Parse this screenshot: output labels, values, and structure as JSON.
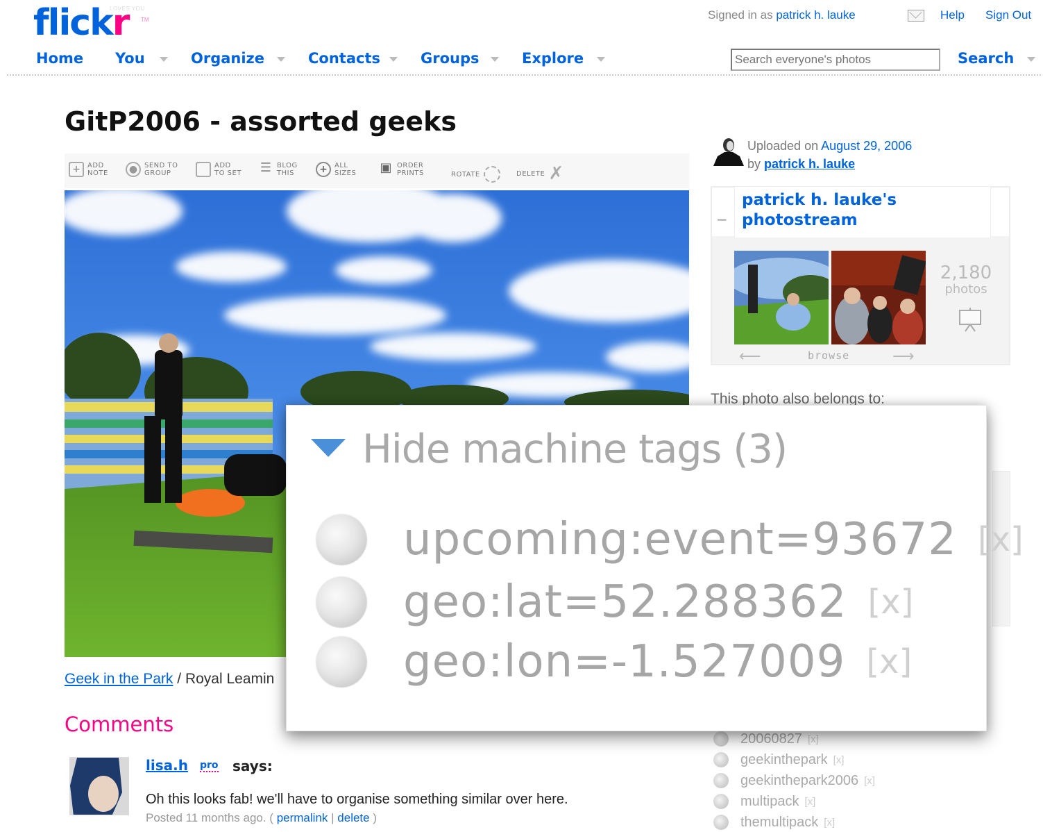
{
  "header": {
    "logo_main": "flick",
    "logo_accent": "r",
    "logo_tagline": "LOVES YOU",
    "logo_tm": "TM",
    "signed_in_prefix": "Signed in as",
    "signed_in_user": "patrick h. lauke",
    "help": "Help",
    "sign_out": "Sign Out"
  },
  "nav": {
    "items": [
      "Home",
      "You",
      "Organize",
      "Contacts",
      "Groups",
      "Explore"
    ]
  },
  "search": {
    "placeholder": "Search everyone's photos",
    "button": "Search"
  },
  "photo": {
    "title": "GitP2006 - assorted geeks"
  },
  "toolbar": {
    "add_note": "ADD\nNOTE",
    "send_to_group": "SEND TO\nGROUP",
    "add_to_set": "ADD\nTO SET",
    "blog_this": "BLOG\nTHIS",
    "all_sizes": "ALL\nSIZES",
    "order_prints": "ORDER\nPRINTS",
    "rotate": "ROTATE",
    "delete": "DELETE"
  },
  "set_path": {
    "set_link": "Geek in the Park",
    "separator": " / ",
    "rest": "Royal Leamin"
  },
  "comments": {
    "heading": "Comments",
    "items": [
      {
        "author": "lisa.h",
        "badge": "pro",
        "says": "says:",
        "text": "Oh this looks fab! we'll have to organise something similar over here.",
        "posted": "Posted 11 months ago. (",
        "permalink": "permalink",
        "sep": " | ",
        "delete": "delete",
        "close": " )"
      }
    ]
  },
  "sidebar": {
    "uploaded_prefix": "Uploaded on",
    "uploaded_date": "August 29, 2006",
    "by": "by",
    "owner": "patrick h. lauke",
    "photostream_title": "patrick h. lauke's photostream",
    "photo_count": "2,180",
    "photo_count_label": "photos",
    "browse": "browse",
    "belongs": "This photo also belongs to:",
    "collapse_symbol": "−"
  },
  "tags": {
    "items": [
      {
        "name": "20060827",
        "remove": "[x]"
      },
      {
        "name": "geekinthepark",
        "remove": "[x]"
      },
      {
        "name": "geekinthepark2006",
        "remove": "[x]"
      },
      {
        "name": "multipack",
        "remove": "[x]"
      },
      {
        "name": "themultipack",
        "remove": "[x]"
      }
    ]
  },
  "machine_tags": {
    "toggle_label": "Hide machine tags (3)",
    "items": [
      {
        "tag": "upcoming:event=93672",
        "remove": "[x]"
      },
      {
        "tag": "geo:lat=52.288362",
        "remove": "[x]"
      },
      {
        "tag": "geo:lon=-1.527009",
        "remove": "[x]"
      }
    ]
  },
  "colors": {
    "link_blue": "#0063dc",
    "flickr_pink": "#ff0084",
    "toggle_blue": "#4a90d9"
  }
}
